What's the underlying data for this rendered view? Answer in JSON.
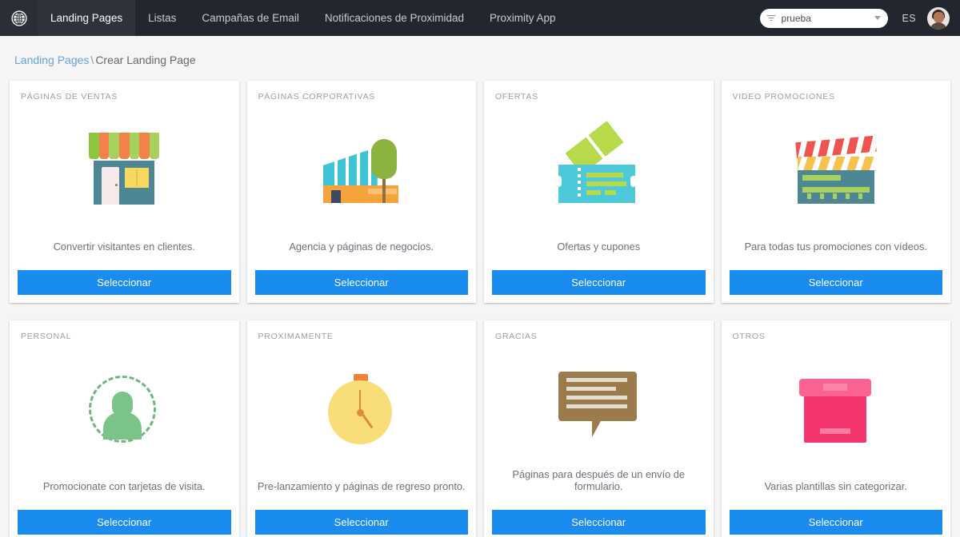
{
  "navbar": {
    "brand_icon": "globe-icon",
    "items": [
      {
        "label": "Landing Pages",
        "active": true
      },
      {
        "label": "Listas",
        "active": false
      },
      {
        "label": "Campañas de Email",
        "active": false
      },
      {
        "label": "Notificaciones de Proximidad",
        "active": false
      },
      {
        "label": "Proximity App",
        "active": false
      }
    ],
    "site_select": {
      "value": "prueba",
      "icon": "filter-icon",
      "caret": "chevron-down-icon"
    },
    "language": "ES",
    "avatar": "user-avatar",
    "bg_color": "#22262e"
  },
  "breadcrumb": {
    "link": "Landing Pages",
    "separator": "\\",
    "current": "Crear Landing Page"
  },
  "colors": {
    "button": "#1a8cf0",
    "card_bg": "#ffffff",
    "page_bg": "#f5f5f5",
    "label": "#9b9fa6"
  },
  "cards": [
    {
      "label": "PÁGINAS DE VENTAS",
      "description": "Convertir visitantes en clientes.",
      "button": "Seleccionar",
      "icon": "storefront-icon"
    },
    {
      "label": "PÁGINAS CORPORATIVAS",
      "description": "Agencia y páginas de negocios.",
      "button": "Seleccionar",
      "icon": "office-building-icon"
    },
    {
      "label": "OFERTAS",
      "description": "Ofertas y cupones",
      "button": "Seleccionar",
      "icon": "tickets-icon"
    },
    {
      "label": "VIDEO PROMOCIONES",
      "description": "Para todas tus promociones con vídeos.",
      "button": "Seleccionar",
      "icon": "clapperboard-icon"
    },
    {
      "label": "PERSONAL",
      "description": "Promocionate con tarjetas de visita.",
      "button": "Seleccionar",
      "icon": "person-circle-icon"
    },
    {
      "label": "PROXIMAMENTE",
      "description": "Pre-lanzamiento y páginas de regreso pronto.",
      "button": "Seleccionar",
      "icon": "stopwatch-icon"
    },
    {
      "label": "GRACIAS",
      "description": "Páginas para después de un envío de formulario.",
      "button": "Seleccionar",
      "icon": "speech-bubble-icon"
    },
    {
      "label": "OTROS",
      "description": "Varias plantillas sin categorizar.",
      "button": "Seleccionar",
      "icon": "box-icon"
    }
  ]
}
